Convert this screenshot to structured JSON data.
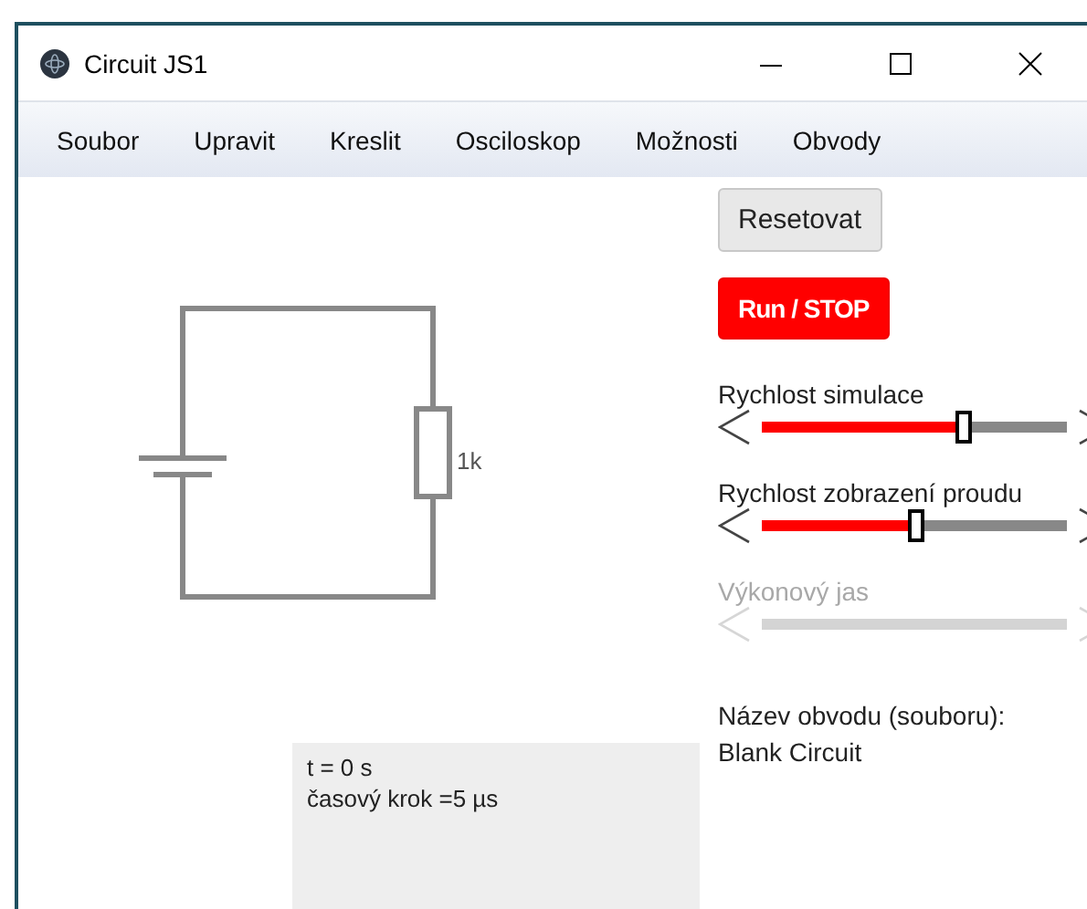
{
  "window": {
    "title": "Circuit JS1"
  },
  "menu": [
    "Soubor",
    "Upravit",
    "Kreslit",
    "Osciloskop",
    "Možnosti",
    "Obvody"
  ],
  "canvas": {
    "resistor_label": "1k"
  },
  "info": [
    "t = 0 s",
    "časový krok =5 µs"
  ],
  "buttons": [
    {
      "label": "Resetovat",
      "kind": "plain"
    },
    {
      "label": "Run / STOP",
      "kind": "run"
    }
  ],
  "sliders": [
    {
      "label": "Rychlost simulace",
      "disabled": false,
      "level": 0.66
    },
    {
      "label": "Rychlost zobrazení proudu",
      "disabled": false,
      "level": 0.5
    },
    {
      "label": "Výkonový jas",
      "disabled": true
    }
  ],
  "circuit_name": {
    "label": "Název obvodu (souboru):",
    "value": "Blank Circuit"
  }
}
